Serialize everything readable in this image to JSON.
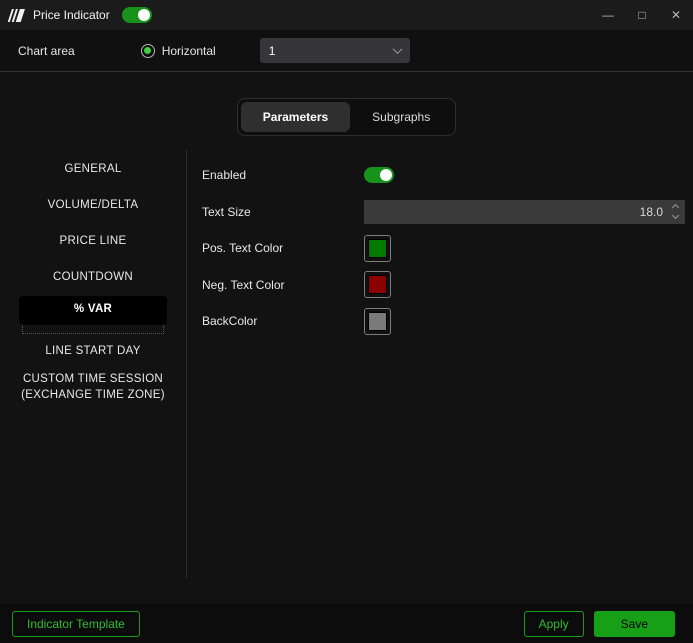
{
  "window": {
    "title": "Price Indicator",
    "title_toggle_state": "on",
    "controls": {
      "minimize": "—",
      "maximize": "□",
      "close": "✕"
    }
  },
  "toolbar": {
    "chart_area_label": "Chart area",
    "orientation_label": "Horizontal",
    "orientation_selected": true,
    "chart_number_value": "1"
  },
  "tabs": [
    {
      "id": "parameters",
      "label": "Parameters",
      "selected": true
    },
    {
      "id": "subgraphs",
      "label": "Subgraphs",
      "selected": false
    }
  ],
  "sidebar": {
    "items": [
      {
        "id": "general",
        "label": "GENERAL",
        "selected": false
      },
      {
        "id": "volume-delta",
        "label": "VOLUME/DELTA",
        "selected": false
      },
      {
        "id": "price-line",
        "label": "PRICE LINE",
        "selected": false
      },
      {
        "id": "countdown",
        "label": "COUNTDOWN",
        "selected": false
      },
      {
        "id": "percent-var",
        "label": "% VAR",
        "selected": true
      },
      {
        "id": "line-start-day",
        "label": "LINE START DAY",
        "selected": false
      },
      {
        "id": "custom-time-session",
        "label": "CUSTOM TIME SESSION\n(EXCHANGE TIME ZONE)",
        "selected": false
      }
    ]
  },
  "panel": {
    "rows": [
      {
        "label": "Enabled",
        "type": "toggle",
        "value": "on"
      },
      {
        "label": "Text Size",
        "type": "number",
        "value": "18.0"
      },
      {
        "label": "Pos. Text Color",
        "type": "color",
        "value": "#007a00"
      },
      {
        "label": "Neg. Text Color",
        "type": "color",
        "value": "#8b0000"
      },
      {
        "label": "BackColor",
        "type": "color",
        "value": "#7a7a7a"
      }
    ]
  },
  "footer": {
    "indicator_template_label": "Indicator Template",
    "apply_label": "Apply",
    "save_label": "Save"
  },
  "colors": {
    "accent_green": "#17a017",
    "toggle_green": "#17931c",
    "pos_text_color": "#007a00",
    "neg_text_color": "#8b0000",
    "back_color": "#7a7a7a"
  }
}
